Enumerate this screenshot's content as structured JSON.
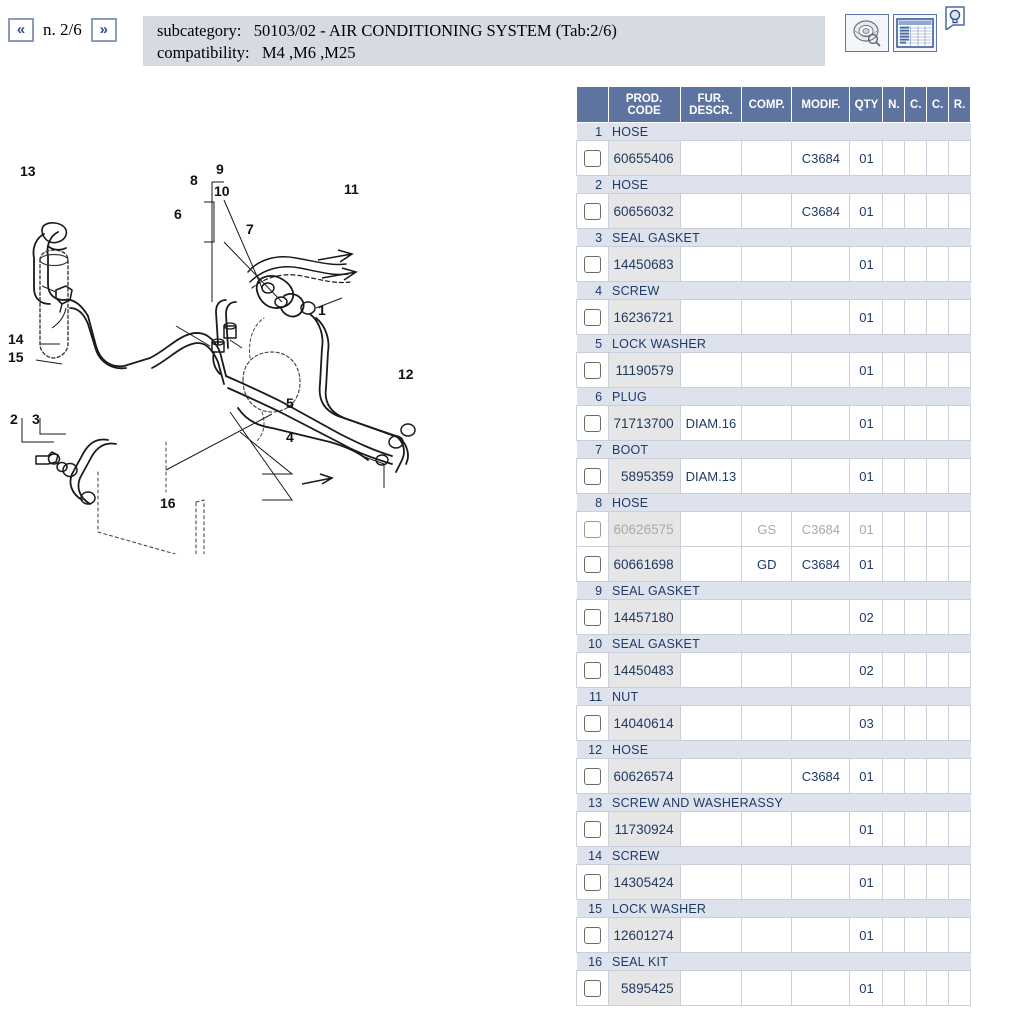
{
  "header": {
    "prev_label": "«",
    "next_label": "»",
    "page_indicator": "n. 2/6",
    "subcategory_label": "subcategory:",
    "subcategory_value": "50103/02 - AIR CONDITIONING SYSTEM (Tab:2/6)",
    "compatibility_label": "compatibility:",
    "compatibility_value": "M4 ,M6 ,M25",
    "icons": {
      "part_view": "wheel-magnifier-icon",
      "list_view": "table-list-icon",
      "help": "lightbulb-icon"
    }
  },
  "colors": {
    "header_band": "#d6dae3",
    "table_header": "#5d73a0",
    "group_row": "#dde2ec",
    "code_cell": "#e6e6e6",
    "text_blue": "#1f3a63",
    "nav_blue": "#2b4b8f"
  },
  "table": {
    "columns": [
      {
        "key": "chk",
        "label": ""
      },
      {
        "key": "code",
        "label": "PROD. CODE"
      },
      {
        "key": "fur",
        "label": "FUR. DESCR."
      },
      {
        "key": "comp",
        "label": "COMP."
      },
      {
        "key": "mod",
        "label": "MODIF."
      },
      {
        "key": "qty",
        "label": "QTY"
      },
      {
        "key": "n",
        "label": "N."
      },
      {
        "key": "c1",
        "label": "C."
      },
      {
        "key": "c2",
        "label": "C."
      },
      {
        "key": "r",
        "label": "R."
      }
    ],
    "column_labels": {
      "code_l1": "PROD.",
      "code_l2": "CODE",
      "fur_l1": "FUR.",
      "fur_l2": "DESCR.",
      "comp": "COMP.",
      "mod": "MODIF.",
      "qty": "QTY",
      "n": "N.",
      "c1": "C.",
      "c2": "C.",
      "r": "R."
    },
    "groups": [
      {
        "num": "1",
        "name": "HOSE",
        "parts": [
          {
            "code": "60655406",
            "fur": "",
            "comp": "",
            "mod": "C3684",
            "qty": "01",
            "n": "",
            "c1": "",
            "c2": "",
            "r": "",
            "disabled": false
          }
        ]
      },
      {
        "num": "2",
        "name": "HOSE",
        "parts": [
          {
            "code": "60656032",
            "fur": "",
            "comp": "",
            "mod": "C3684",
            "qty": "01",
            "n": "",
            "c1": "",
            "c2": "",
            "r": "",
            "disabled": false
          }
        ]
      },
      {
        "num": "3",
        "name": "SEAL GASKET",
        "parts": [
          {
            "code": "14450683",
            "fur": "",
            "comp": "",
            "mod": "",
            "qty": "01",
            "n": "",
            "c1": "",
            "c2": "",
            "r": "",
            "disabled": false
          }
        ]
      },
      {
        "num": "4",
        "name": "SCREW",
        "parts": [
          {
            "code": "16236721",
            "fur": "",
            "comp": "",
            "mod": "",
            "qty": "01",
            "n": "",
            "c1": "",
            "c2": "",
            "r": "",
            "disabled": false
          }
        ]
      },
      {
        "num": "5",
        "name": "LOCK WASHER",
        "parts": [
          {
            "code": "11190579",
            "fur": "",
            "comp": "",
            "mod": "",
            "qty": "01",
            "n": "",
            "c1": "",
            "c2": "",
            "r": "",
            "disabled": false
          }
        ]
      },
      {
        "num": "6",
        "name": "PLUG",
        "parts": [
          {
            "code": "71713700",
            "fur": "DIAM.16",
            "comp": "",
            "mod": "",
            "qty": "01",
            "n": "",
            "c1": "",
            "c2": "",
            "r": "",
            "disabled": false
          }
        ]
      },
      {
        "num": "7",
        "name": "BOOT",
        "parts": [
          {
            "code": "5895359",
            "fur": "DIAM.13",
            "comp": "",
            "mod": "",
            "qty": "01",
            "n": "",
            "c1": "",
            "c2": "",
            "r": "",
            "disabled": false
          }
        ]
      },
      {
        "num": "8",
        "name": "HOSE",
        "parts": [
          {
            "code": "60626575",
            "fur": "",
            "comp": "GS",
            "mod": "C3684",
            "qty": "01",
            "n": "",
            "c1": "",
            "c2": "",
            "r": "",
            "disabled": true
          },
          {
            "code": "60661698",
            "fur": "",
            "comp": "GD",
            "mod": "C3684",
            "qty": "01",
            "n": "",
            "c1": "",
            "c2": "",
            "r": "",
            "disabled": false
          }
        ]
      },
      {
        "num": "9",
        "name": "SEAL GASKET",
        "parts": [
          {
            "code": "14457180",
            "fur": "",
            "comp": "",
            "mod": "",
            "qty": "02",
            "n": "",
            "c1": "",
            "c2": "",
            "r": "",
            "disabled": false
          }
        ]
      },
      {
        "num": "10",
        "name": "SEAL GASKET",
        "parts": [
          {
            "code": "14450483",
            "fur": "",
            "comp": "",
            "mod": "",
            "qty": "02",
            "n": "",
            "c1": "",
            "c2": "",
            "r": "",
            "disabled": false
          }
        ]
      },
      {
        "num": "11",
        "name": "NUT",
        "parts": [
          {
            "code": "14040614",
            "fur": "",
            "comp": "",
            "mod": "",
            "qty": "03",
            "n": "",
            "c1": "",
            "c2": "",
            "r": "",
            "disabled": false
          }
        ]
      },
      {
        "num": "12",
        "name": "HOSE",
        "parts": [
          {
            "code": "60626574",
            "fur": "",
            "comp": "",
            "mod": "C3684",
            "qty": "01",
            "n": "",
            "c1": "",
            "c2": "",
            "r": "",
            "disabled": false
          }
        ]
      },
      {
        "num": "13",
        "name": "SCREW AND WASHERASSY",
        "parts": [
          {
            "code": "11730924",
            "fur": "",
            "comp": "",
            "mod": "",
            "qty": "01",
            "n": "",
            "c1": "",
            "c2": "",
            "r": "",
            "disabled": false
          }
        ]
      },
      {
        "num": "14",
        "name": "SCREW",
        "parts": [
          {
            "code": "14305424",
            "fur": "",
            "comp": "",
            "mod": "",
            "qty": "01",
            "n": "",
            "c1": "",
            "c2": "",
            "r": "",
            "disabled": false
          }
        ]
      },
      {
        "num": "15",
        "name": "LOCK WASHER",
        "parts": [
          {
            "code": "12601274",
            "fur": "",
            "comp": "",
            "mod": "",
            "qty": "01",
            "n": "",
            "c1": "",
            "c2": "",
            "r": "",
            "disabled": false
          }
        ]
      },
      {
        "num": "16",
        "name": "SEAL KIT",
        "parts": [
          {
            "code": "5895425",
            "fur": "",
            "comp": "",
            "mod": "",
            "qty": "01",
            "n": "",
            "c1": "",
            "c2": "",
            "r": "",
            "disabled": false
          }
        ]
      }
    ]
  },
  "diagram": {
    "title": "air-conditioning-system-exploded-view",
    "callouts": [
      "1",
      "2",
      "3",
      "4",
      "5",
      "6",
      "7",
      "8",
      "9",
      "10",
      "11",
      "12",
      "13",
      "14",
      "15",
      "16"
    ]
  }
}
